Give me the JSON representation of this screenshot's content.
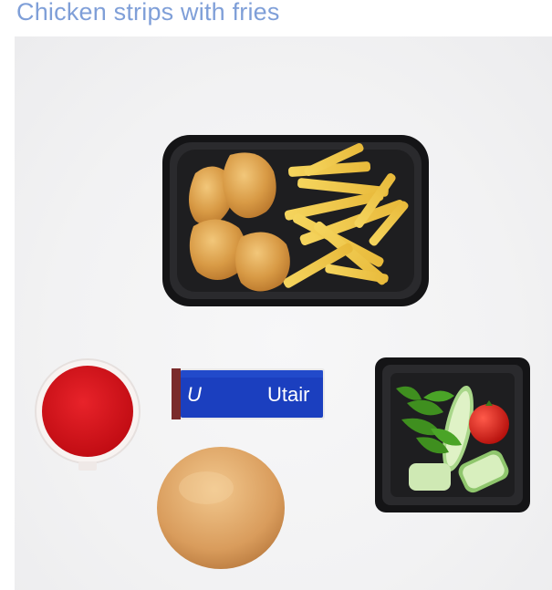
{
  "page": {
    "title": "Chicken strips with fries"
  },
  "meal_items": [
    "main-tray-chicken-fries",
    "ketchup-cup",
    "candy-bar",
    "bread-roll",
    "vegetable-salad-box"
  ],
  "candy_bar": {
    "brand_text": "Utair",
    "logo_glyph": "U",
    "color": "#1b3fbf"
  },
  "colors": {
    "title": "#7f9fd8",
    "tray": "#1c1c1e",
    "ketchup": "#d8141a"
  }
}
